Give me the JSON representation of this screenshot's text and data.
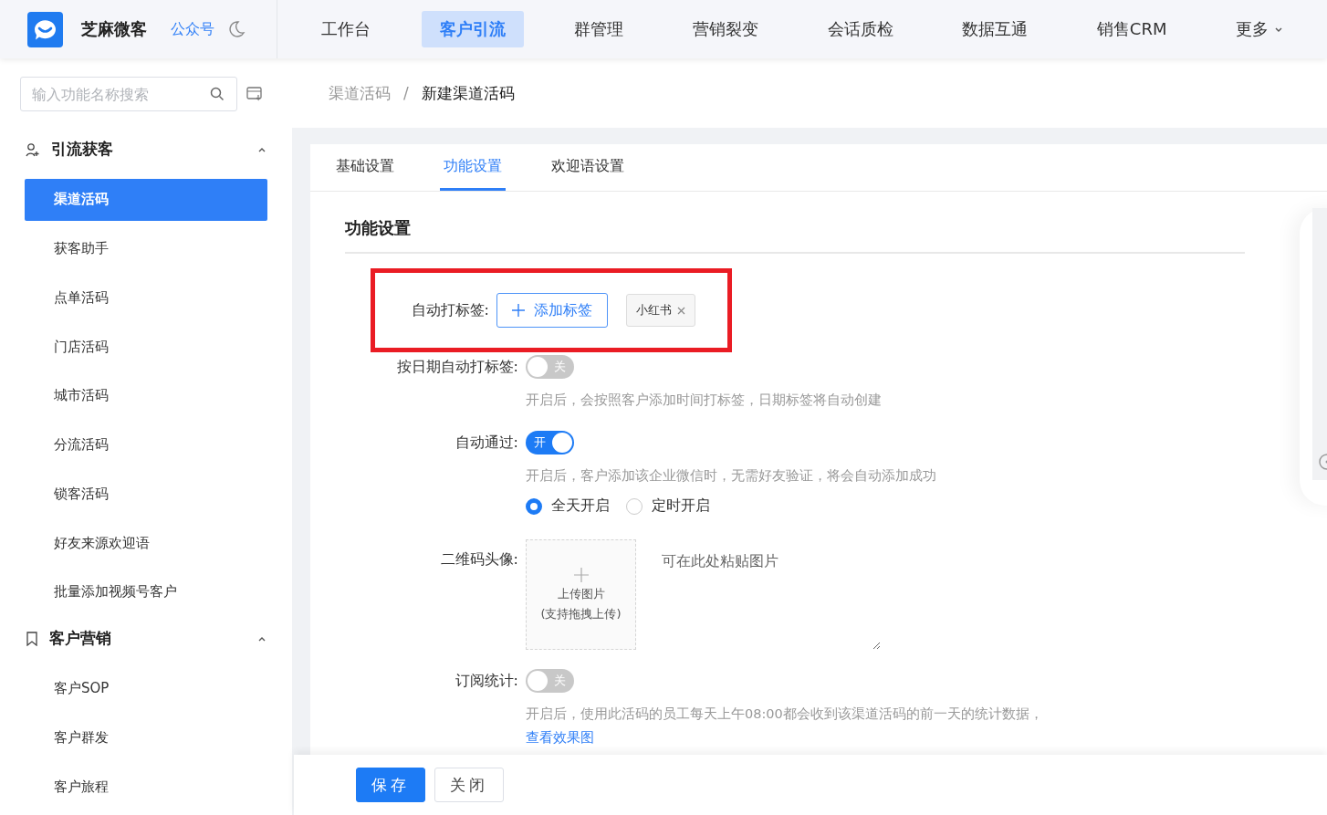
{
  "brand": {
    "name": "芝麻微客",
    "link": "公众号"
  },
  "nav": [
    {
      "label": "工作台",
      "selected": false
    },
    {
      "label": "客户引流",
      "selected": true
    },
    {
      "label": "群管理",
      "selected": false
    },
    {
      "label": "营销裂变",
      "selected": false
    },
    {
      "label": "会话质检",
      "selected": false
    },
    {
      "label": "数据互通",
      "selected": false
    },
    {
      "label": "销售CRM",
      "selected": false
    },
    {
      "label": "更多",
      "selected": false,
      "dropdown": true
    }
  ],
  "breadcrumb_separator": "/",
  "sidebar": {
    "search": {
      "placeholder": "输入功能名称搜索"
    },
    "groups": [
      {
        "title": "引流获客",
        "expanded": true,
        "items": [
          {
            "label": "渠道活码",
            "selected": true
          },
          {
            "label": "获客助手",
            "selected": false
          },
          {
            "label": "点单活码",
            "selected": false
          },
          {
            "label": "门店活码",
            "selected": false
          },
          {
            "label": "城市活码",
            "selected": false
          },
          {
            "label": "分流活码",
            "selected": false
          },
          {
            "label": "锁客活码",
            "selected": false
          },
          {
            "label": "好友来源欢迎语",
            "selected": false
          },
          {
            "label": "批量添加视频号客户",
            "selected": false
          }
        ]
      },
      {
        "title": "客户营销",
        "expanded": true,
        "items": [
          {
            "label": "客户SOP",
            "selected": false
          },
          {
            "label": "客户群发",
            "selected": false
          },
          {
            "label": "客户旅程",
            "selected": false
          }
        ]
      }
    ]
  },
  "breadcrumb": [
    "渠道活码",
    "新建渠道活码"
  ],
  "tabs": [
    {
      "label": "基础设置",
      "selected": false
    },
    {
      "label": "功能设置",
      "selected": true
    },
    {
      "label": "欢迎语设置",
      "selected": false
    }
  ],
  "section_title": "功能设置",
  "form": [
    {
      "kind": "tags",
      "label": "自动打标签:",
      "button": "添加标签",
      "tags": [
        "小红书"
      ],
      "highlighted": true
    },
    {
      "kind": "switch",
      "label": "按日期自动打标签:",
      "on": false,
      "switch_text": "关",
      "help": "开启后，会按照客户添加时间打标签，日期标签将自动创建"
    },
    {
      "kind": "switch",
      "label": "自动通过:",
      "on": true,
      "switch_text": "开",
      "help": "开启后，客户添加该企业微信时，无需好友验证，将会自动添加成功",
      "options": [
        {
          "label": "全天开启",
          "selected": true
        },
        {
          "label": "定时开启",
          "selected": false
        }
      ]
    },
    {
      "kind": "upload",
      "label": "二维码头像:",
      "upload_text": "上传图片",
      "upload_hint": "(支持拖拽上传)",
      "paste_placeholder": "可在此处粘贴图片"
    },
    {
      "kind": "switch",
      "label": "订阅统计:",
      "on": false,
      "switch_text": "关",
      "help": "开启后，使用此活码的员工每天上午08:00都会收到该渠道活码的前一天的统计数据，",
      "help_link": "查看效果图"
    }
  ],
  "footer": {
    "buttons": [
      {
        "label": "保存",
        "kind": "primary"
      },
      {
        "label": "关闭",
        "kind": "default"
      }
    ]
  }
}
